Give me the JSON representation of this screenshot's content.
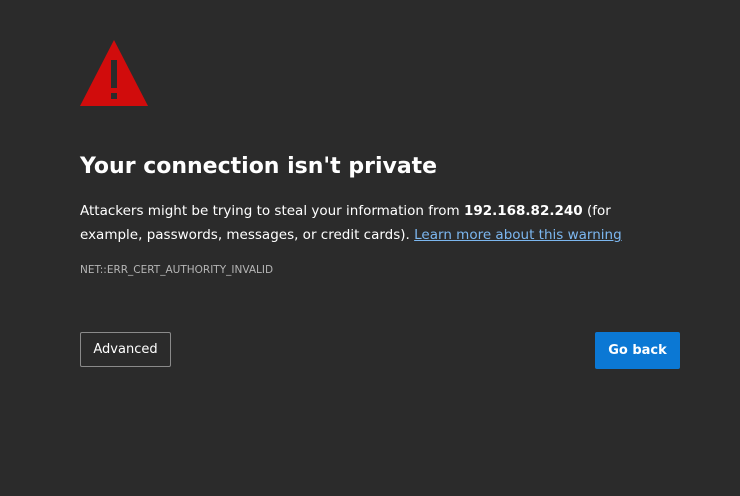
{
  "icon": {
    "name": "warning-triangle-icon",
    "color": "#d10c0c"
  },
  "title": "Your connection isn't private",
  "message": {
    "part1": "Attackers might be trying to steal your information from ",
    "host": "192.168.82.240",
    "part2": " (for example, passwords, messages, or credit cards). ",
    "link": "Learn more about this warning"
  },
  "error_code": "NET::ERR_CERT_AUTHORITY_INVALID",
  "buttons": {
    "advanced": "Advanced",
    "go_back": "Go back"
  },
  "colors": {
    "background": "#2b2b2b",
    "primary_button": "#0b78d4",
    "link": "#7cb7f0"
  }
}
